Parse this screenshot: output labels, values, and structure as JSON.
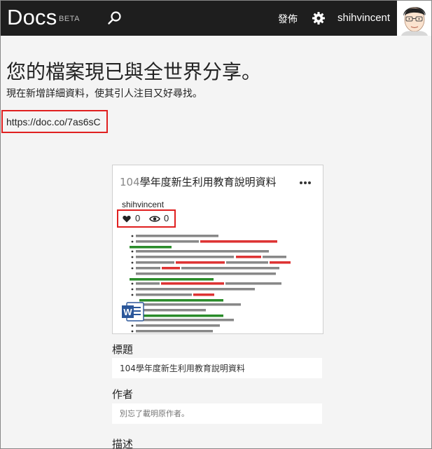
{
  "header": {
    "brand": "Docs",
    "beta": "BETA",
    "publish_label": "發佈",
    "username": "shihvincent"
  },
  "main": {
    "headline": "您的檔案現已與全世界分享。",
    "subline": "現在新增詳細資料，使其引人注目又好尋找。",
    "share_url": "https://doc.co/7as6sC"
  },
  "card": {
    "title_number": "104",
    "title_text": "學年度新生利用教育說明資料",
    "author": "shihvincent",
    "likes": "0",
    "views": "0"
  },
  "form": {
    "title_label": "標題",
    "title_value": "104學年度新生利用教育說明資料",
    "author_label": "作者",
    "author_placeholder": "別忘了載明原作者。",
    "description_label": "描述"
  },
  "colors": {
    "topbar": "#1e1e1e",
    "highlight": "#e02020",
    "background": "#f4f4f4",
    "word_blue": "#2b579a"
  }
}
